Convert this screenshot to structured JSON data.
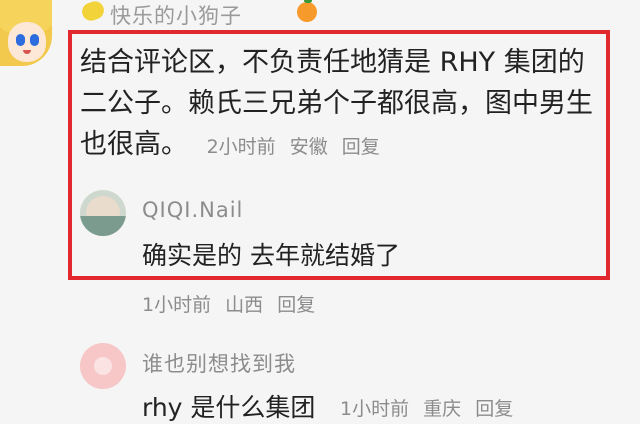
{
  "comment": {
    "author": "快乐的小狗子",
    "lines": [
      "结合评论区，不负责任地猜是 RHY 集团的",
      "二公子。赖氏三兄弟个子都很高，图中男生",
      "也很高。"
    ],
    "time": "2小时前",
    "location": "安徽",
    "reply_label": "回复"
  },
  "reply": {
    "author": "QIQI.Nail",
    "text": "确实是的 去年就结婚了",
    "time": "1小时前",
    "location": "山西",
    "reply_label": "回复"
  },
  "third": {
    "author": "谁也别想找到我",
    "text": "rhy 是什么集团",
    "time": "1小时前",
    "location": "重庆",
    "reply_label": "回复"
  },
  "icons": {
    "avatar_1": "avatar-anime-girl",
    "emoji_left": "lemon-emoji",
    "emoji_right": "orange-emoji",
    "avatar_2": "avatar-photo",
    "avatar_3": "avatar-pink"
  },
  "colors": {
    "highlight_border": "#e0282e",
    "meta_text": "#8c8c8c"
  }
}
